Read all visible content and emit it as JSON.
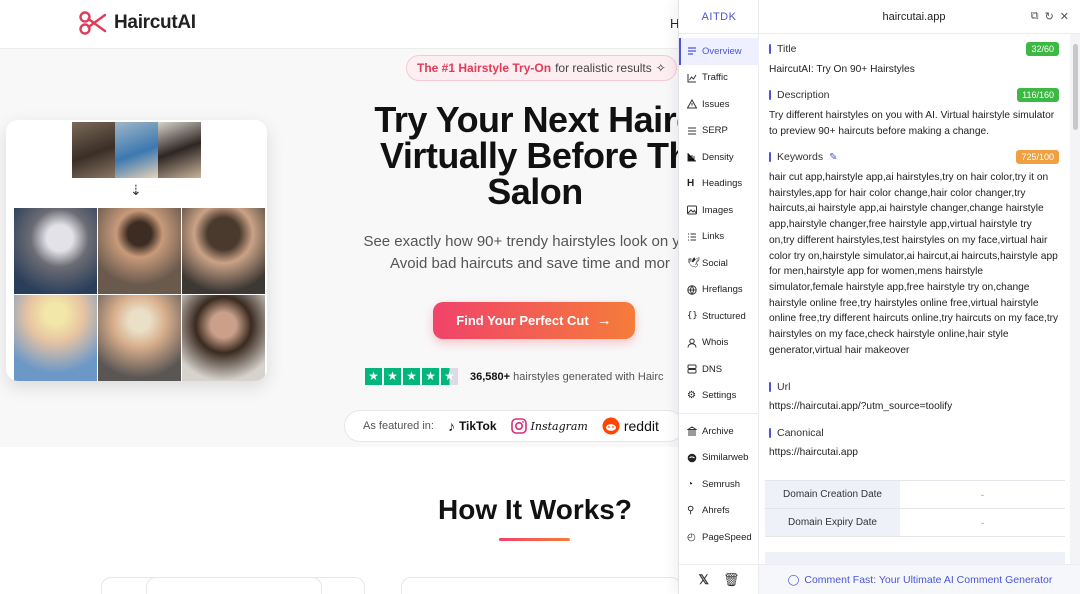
{
  "site": {
    "logo_text": "HaircutAI",
    "nav_partial": "H",
    "badge_strong": "The #1 Hairstyle Try-On",
    "badge_rest": "for realistic results",
    "hero_title_line1": "Try Your Next Hairc",
    "hero_title_line2": "Virtually Before Th",
    "hero_title_line3": "Salon",
    "hero_sub_line1": "See exactly how 90+ trendy hairstyles look on you",
    "hero_sub_line2": "Avoid bad haircuts and save time and mor",
    "cta_label": "Find Your Perfect Cut",
    "rating_count": "36,580+",
    "rating_text": "hairstyles generated with Hairc",
    "featured_label": "As featured in:",
    "brands": [
      "TikTok",
      "Instagram",
      "reddit"
    ],
    "how_title": "How It Works?"
  },
  "ext": {
    "brand": "AITDK",
    "domain": "haircutai.app",
    "menu": [
      {
        "label": "Overview",
        "icon": "list-icon"
      },
      {
        "label": "Traffic",
        "icon": "chart-icon"
      },
      {
        "label": "Issues",
        "icon": "warning-icon"
      },
      {
        "label": "SERP",
        "icon": "serp-icon"
      },
      {
        "label": "Density",
        "icon": "density-icon"
      },
      {
        "label": "Headings",
        "icon": "heading-icon"
      },
      {
        "label": "Images",
        "icon": "image-icon"
      },
      {
        "label": "Links",
        "icon": "links-icon"
      },
      {
        "label": "Social",
        "icon": "twitter-icon"
      },
      {
        "label": "Hreflangs",
        "icon": "globe-icon"
      },
      {
        "label": "Structured",
        "icon": "braces-icon"
      },
      {
        "label": "Whois",
        "icon": "person-icon"
      },
      {
        "label": "DNS",
        "icon": "server-icon"
      },
      {
        "label": "Settings",
        "icon": "gear-icon"
      }
    ],
    "tools": [
      {
        "label": "Archive",
        "icon": "archive-icon"
      },
      {
        "label": "Similarweb",
        "icon": "similarweb-icon"
      },
      {
        "label": "Semrush",
        "icon": "semrush-icon"
      },
      {
        "label": "Ahrefs",
        "icon": "ahrefs-icon"
      },
      {
        "label": "PageSpeed",
        "icon": "pagespeed-icon"
      }
    ],
    "title": {
      "label": "Title",
      "count": "32/60",
      "value": "HaircutAI: Try On 90+ Hairstyles"
    },
    "description": {
      "label": "Description",
      "count": "116/160",
      "value": "Try different hairstyles on you with AI. Virtual hairstyle simulator to preview 90+ haircuts before making a change."
    },
    "keywords": {
      "label": "Keywords",
      "count": "725/100",
      "value": "hair cut app,hairstyle app,ai hairstyles,try on hair color,try it on hairstyles,app for hair color change,hair color changer,try haircuts,ai hairstyle app,ai hairstyle changer,change hairstyle app,hairstyle changer,free hairstyle app,virtual hairstyle try on,try different hairstyles,test hairstyles on my face,virtual hair color try on,hairstyle simulator,ai haircut,ai haircuts,hairstyle app for men,hairstyle app for women,mens hairstyle simulator,female hairstyle app,free hairstyle try on,change hairstyle online free,try hairstyles online free,virtual hairstyle online free,try different haircuts online,try haircuts on my face,try hairstyles on my face,check hairstyle online,hair style generator,virtual hair makeover"
    },
    "url": {
      "label": "Url",
      "value": "https://haircutai.app/?utm_source=toolify"
    },
    "canonical": {
      "label": "Canonical",
      "value": "https://haircutai.app"
    },
    "domain_rows": [
      {
        "label": "Domain Creation Date",
        "value": "-"
      },
      {
        "label": "Domain Expiry Date",
        "value": "-"
      }
    ],
    "footer_promo": "Comment Fast: Your Ultimate AI Comment Generator"
  }
}
